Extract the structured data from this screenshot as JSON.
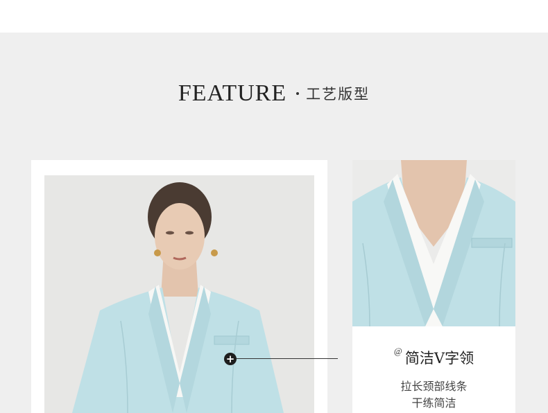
{
  "section": {
    "title_en": "FEATURE",
    "title_cn": "工艺版型"
  },
  "feature": {
    "marker": "@",
    "title": "简洁V字领",
    "desc_line1": "拉长颈部线条",
    "desc_line2": "干练简洁",
    "callout_icon": "plus-icon"
  },
  "colors": {
    "background": "#efefef",
    "jacket": "#bfe0e6",
    "inner_top": "#ffffff"
  }
}
